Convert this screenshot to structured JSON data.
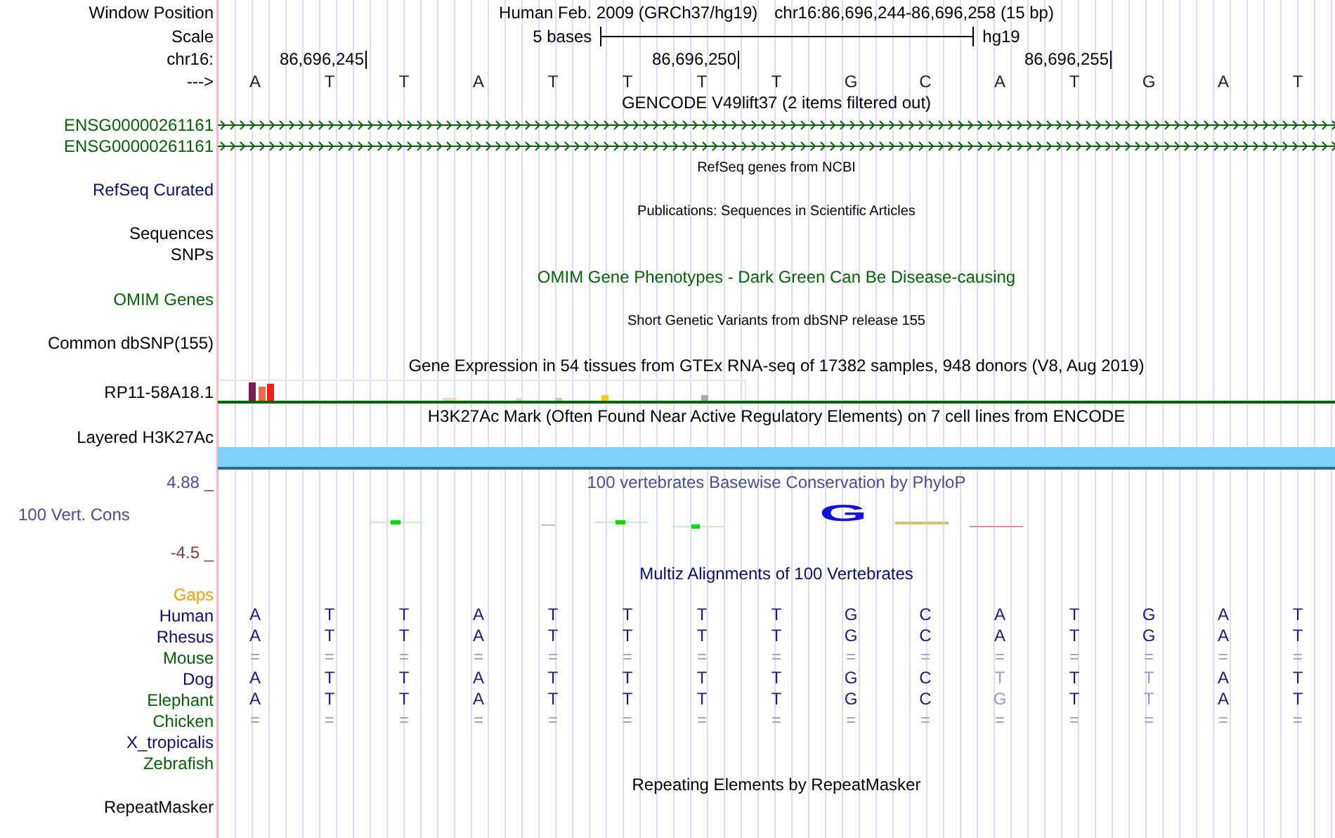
{
  "header": {
    "window_label": "Window Position",
    "assembly": "Human Feb. 2009 (GRCh37/hg19)",
    "region": "chr16:86,696,244-86,696,258 (15 bp)",
    "scale_label": "Scale",
    "scale_text": "5 bases",
    "scale_db": "hg19",
    "chrom_label": "chr16:",
    "positions": [
      "86,696,245",
      "86,696,250",
      "86,696,255"
    ],
    "strand_label": "--->",
    "bases": [
      "A",
      "T",
      "T",
      "A",
      "T",
      "T",
      "T",
      "T",
      "G",
      "C",
      "A",
      "T",
      "G",
      "A",
      "T"
    ]
  },
  "tracks": [
    {
      "kind": "genes",
      "title": "GENCODE V49lift37 (2 items filtered out)",
      "color": "#000000",
      "labels": [
        {
          "text": "ENSG00000261161",
          "color": "#006400"
        },
        {
          "text": "ENSG00000261161",
          "color": "#006400"
        }
      ]
    },
    {
      "kind": "refseq",
      "title": "RefSeq genes from NCBI",
      "color": "#000000",
      "labels": [
        {
          "text": "RefSeq Curated",
          "color": "#0c0c78"
        }
      ]
    },
    {
      "kind": "publications",
      "title": "Publications: Sequences in Scientific Articles",
      "color": "#000000",
      "labels": [
        {
          "text": "Sequences",
          "color": "#000000"
        },
        {
          "text": "SNPs",
          "color": "#000000"
        }
      ]
    },
    {
      "kind": "omim",
      "title": "OMIM Gene Phenotypes - Dark Green Can Be Disease-causing",
      "color": "#006600",
      "labels": [
        {
          "text": "OMIM Genes",
          "color": "#006600"
        }
      ]
    },
    {
      "kind": "dbsnp",
      "title": "Short Genetic Variants from dbSNP release 155",
      "color": "#000000",
      "labels": [
        {
          "text": "Common dbSNP(155)",
          "color": "#000000"
        }
      ]
    },
    {
      "kind": "expression",
      "title": "Gene Expression in 54 tissues from GTEx RNA-seq of 17382 samples, 948 donors (V8, Aug 2019)",
      "color": "#000000",
      "labels": [
        {
          "text": "RP11-58A18.1",
          "color": "#000000"
        }
      ]
    },
    {
      "kind": "h3k27ac",
      "title": "H3K27Ac Mark (Often Found Near Active Regulatory Elements) on 7 cell lines from ENCODE",
      "color": "#000000",
      "labels": [
        {
          "text": "Layered H3K27Ac",
          "color": "#000000"
        }
      ]
    },
    {
      "kind": "conservation",
      "title": "100 vertebrates Basewise Conservation by PhyloP",
      "color": "#4b4b9b",
      "max": "4.88 _",
      "min": "-4.5 _",
      "logo_base": "G",
      "labels": [
        {
          "text": "100 Vert. Cons",
          "color": "#4b4b9b"
        }
      ]
    },
    {
      "kind": "alignment",
      "title": "Multiz Alignments of 100 Vertebrates",
      "color": "#0c0c78",
      "gaps": {
        "text": "Gaps",
        "color": "#ff9900"
      },
      "species": [
        {
          "name": "Human",
          "color": "#0c0c78",
          "bases": [
            {
              "b": "A",
              "faint": false
            },
            {
              "b": "T",
              "faint": false
            },
            {
              "b": "T",
              "faint": false
            },
            {
              "b": "A",
              "faint": false
            },
            {
              "b": "T",
              "faint": false
            },
            {
              "b": "T",
              "faint": false
            },
            {
              "b": "T",
              "faint": false
            },
            {
              "b": "T",
              "faint": false
            },
            {
              "b": "G",
              "faint": false
            },
            {
              "b": "C",
              "faint": false
            },
            {
              "b": "A",
              "faint": false
            },
            {
              "b": "T",
              "faint": false
            },
            {
              "b": "G",
              "faint": false
            },
            {
              "b": "A",
              "faint": false
            },
            {
              "b": "T",
              "faint": false
            }
          ]
        },
        {
          "name": "Rhesus",
          "color": "#0c0c78",
          "bases": [
            {
              "b": "A",
              "faint": false
            },
            {
              "b": "T",
              "faint": false
            },
            {
              "b": "T",
              "faint": false
            },
            {
              "b": "A",
              "faint": false
            },
            {
              "b": "T",
              "faint": false
            },
            {
              "b": "T",
              "faint": false
            },
            {
              "b": "T",
              "faint": false
            },
            {
              "b": "T",
              "faint": false
            },
            {
              "b": "G",
              "faint": false
            },
            {
              "b": "C",
              "faint": false
            },
            {
              "b": "A",
              "faint": false
            },
            {
              "b": "T",
              "faint": false
            },
            {
              "b": "G",
              "faint": false
            },
            {
              "b": "A",
              "faint": false
            },
            {
              "b": "T",
              "faint": false
            }
          ]
        },
        {
          "name": "Mouse",
          "color": "#006400",
          "bases": [
            {
              "b": "=",
              "faint": true
            },
            {
              "b": "=",
              "faint": true
            },
            {
              "b": "=",
              "faint": true
            },
            {
              "b": "=",
              "faint": true
            },
            {
              "b": "=",
              "faint": true
            },
            {
              "b": "=",
              "faint": true
            },
            {
              "b": "=",
              "faint": true
            },
            {
              "b": "=",
              "faint": true
            },
            {
              "b": "=",
              "faint": true
            },
            {
              "b": "=",
              "faint": true
            },
            {
              "b": "=",
              "faint": true
            },
            {
              "b": "=",
              "faint": true
            },
            {
              "b": "=",
              "faint": true
            },
            {
              "b": "=",
              "faint": true
            },
            {
              "b": "=",
              "faint": true
            }
          ]
        },
        {
          "name": "Dog",
          "color": "#0c0c78",
          "bases": [
            {
              "b": "A",
              "faint": false
            },
            {
              "b": "T",
              "faint": false
            },
            {
              "b": "T",
              "faint": false
            },
            {
              "b": "A",
              "faint": false
            },
            {
              "b": "T",
              "faint": false
            },
            {
              "b": "T",
              "faint": false
            },
            {
              "b": "T",
              "faint": false
            },
            {
              "b": "T",
              "faint": false
            },
            {
              "b": "G",
              "faint": false
            },
            {
              "b": "C",
              "faint": false
            },
            {
              "b": "T",
              "faint": true
            },
            {
              "b": "T",
              "faint": false
            },
            {
              "b": "T",
              "faint": true
            },
            {
              "b": "A",
              "faint": false
            },
            {
              "b": "T",
              "faint": false
            }
          ]
        },
        {
          "name": "Elephant",
          "color": "#006400",
          "bases": [
            {
              "b": "A",
              "faint": false
            },
            {
              "b": "T",
              "faint": false
            },
            {
              "b": "T",
              "faint": false
            },
            {
              "b": "A",
              "faint": false
            },
            {
              "b": "T",
              "faint": false
            },
            {
              "b": "T",
              "faint": false
            },
            {
              "b": "T",
              "faint": false
            },
            {
              "b": "T",
              "faint": false
            },
            {
              "b": "G",
              "faint": false
            },
            {
              "b": "C",
              "faint": false
            },
            {
              "b": "G",
              "faint": true
            },
            {
              "b": "T",
              "faint": false
            },
            {
              "b": "T",
              "faint": true
            },
            {
              "b": "A",
              "faint": false
            },
            {
              "b": "T",
              "faint": false
            }
          ]
        },
        {
          "name": "Chicken",
          "color": "#006400",
          "bases": [
            {
              "b": "=",
              "faint": true
            },
            {
              "b": "=",
              "faint": true
            },
            {
              "b": "=",
              "faint": true
            },
            {
              "b": "=",
              "faint": true
            },
            {
              "b": "=",
              "faint": true
            },
            {
              "b": "=",
              "faint": true
            },
            {
              "b": "=",
              "faint": true
            },
            {
              "b": "=",
              "faint": true
            },
            {
              "b": "=",
              "faint": true
            },
            {
              "b": "=",
              "faint": true
            },
            {
              "b": "=",
              "faint": true
            },
            {
              "b": "=",
              "faint": true
            },
            {
              "b": "=",
              "faint": true
            },
            {
              "b": "=",
              "faint": true
            },
            {
              "b": "=",
              "faint": true
            }
          ]
        },
        {
          "name": "X_tropicalis",
          "color": "#0c0c78"
        },
        {
          "name": "Zebrafish",
          "color": "#006400"
        }
      ]
    },
    {
      "kind": "repeats",
      "title": "Repeating Elements by RepeatMasker",
      "color": "#000000",
      "labels": [
        {
          "text": "RepeatMasker",
          "color": "#000000"
        }
      ]
    }
  ]
}
